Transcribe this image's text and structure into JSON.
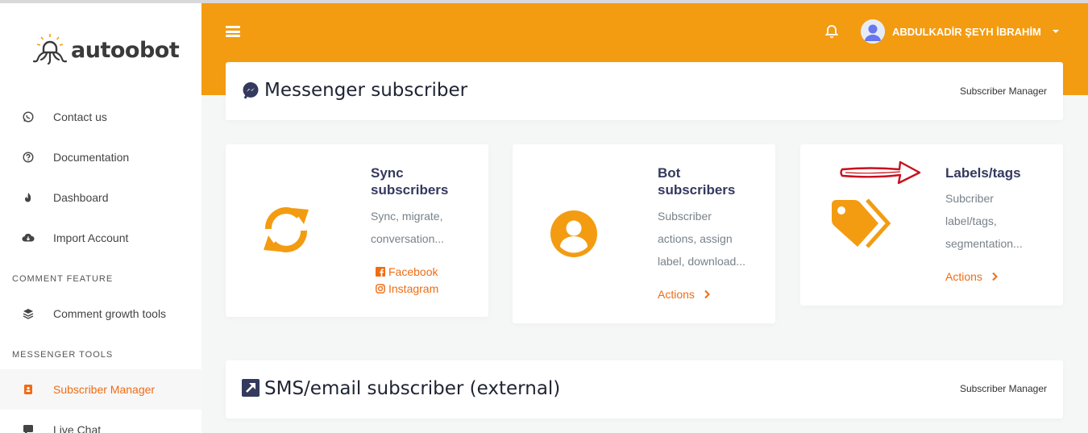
{
  "app": {
    "brand": "autoobot"
  },
  "sidebar": {
    "items": [
      {
        "label": "Contact us",
        "icon": "whatsapp-icon"
      },
      {
        "label": "Documentation",
        "icon": "question-circle-icon"
      },
      {
        "label": "Dashboard",
        "icon": "fire-icon"
      },
      {
        "label": "Import Account",
        "icon": "cloud-download-icon"
      }
    ],
    "section_comment": "COMMENT FEATURE",
    "comment_items": [
      {
        "label": "Comment growth tools",
        "icon": "layers-icon"
      }
    ],
    "section_messenger": "MESSENGER TOOLS",
    "messenger_items": [
      {
        "label": "Subscriber Manager",
        "icon": "contact-book-icon",
        "active": true
      },
      {
        "label": "Live Chat",
        "icon": "chat-icon"
      }
    ]
  },
  "header": {
    "username": "ABDULKADİR ŞEYH İBRAHİM"
  },
  "sections": [
    {
      "title": "Messenger subscriber",
      "link": "Subscriber Manager",
      "icon": "messenger-icon"
    },
    {
      "title": "SMS/email subscriber (external)",
      "link": "Subscriber Manager",
      "icon": "external-link-icon"
    }
  ],
  "cards": {
    "sync": {
      "title_line1": "Sync",
      "title_line2": "subscribers",
      "desc_line1": "Sync, migrate,",
      "desc_line2": "conversation...",
      "facebook": "Facebook",
      "instagram": "Instagram"
    },
    "bot": {
      "title_line1": "Bot",
      "title_line2": "subscribers",
      "desc_line1": "Subscriber",
      "desc_line2": "actions, assign",
      "desc_line3": "label, download...",
      "action": "Actions"
    },
    "labels": {
      "title": "Labels/tags",
      "desc_line1": "Subcriber",
      "desc_line2": "label/tags,",
      "desc_line3": "segmentation...",
      "action": "Actions"
    }
  },
  "colors": {
    "accent": "#f39c12",
    "link": "#ef6c14"
  }
}
